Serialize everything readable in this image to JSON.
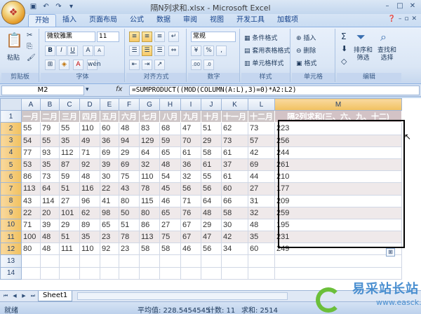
{
  "window": {
    "title": "隔N列求和.xlsx - Microsoft Excel"
  },
  "tabs": [
    "开始",
    "插入",
    "页面布局",
    "公式",
    "数据",
    "审阅",
    "视图",
    "开发工具",
    "加载项"
  ],
  "ribbon": {
    "clipboard": {
      "paste": "粘贴",
      "label": "剪贴板"
    },
    "font": {
      "name": "微软雅黑",
      "size": "11",
      "label": "字体"
    },
    "align": {
      "label": "对齐方式"
    },
    "number": {
      "format": "常规",
      "label": "数字"
    },
    "styles": {
      "cond": "条件格式",
      "table": "套用表格格式",
      "cell": "单元格样式",
      "label": "样式"
    },
    "cells": {
      "insert": "插入",
      "delete": "删除",
      "format": "格式",
      "label": "单元格"
    },
    "edit": {
      "sort": "排序和\n筛选",
      "find": "查找和\n选择",
      "label": "编辑"
    }
  },
  "formula_bar": {
    "name_box": "M2",
    "fx": "fx",
    "formula": "=SUMPRODUCT((MOD(COLUMN(A:L),3)=0)*A2:L2)"
  },
  "sheet": {
    "columns": [
      "A",
      "B",
      "C",
      "D",
      "E",
      "F",
      "G",
      "H",
      "I",
      "J",
      "K",
      "L",
      "M"
    ],
    "header": [
      "一月",
      "二月",
      "三月",
      "四月",
      "五月",
      "六月",
      "七月",
      "八月",
      "九月",
      "十月",
      "十一月",
      "十二月",
      "隔2列求和(三、六、九、十二)"
    ],
    "rows": [
      [
        55,
        79,
        55,
        110,
        60,
        48,
        83,
        68,
        47,
        51,
        62,
        73,
        223
      ],
      [
        54,
        55,
        35,
        49,
        36,
        94,
        129,
        59,
        70,
        29,
        73,
        57,
        256
      ],
      [
        77,
        93,
        112,
        71,
        69,
        29,
        64,
        65,
        61,
        58,
        61,
        42,
        244
      ],
      [
        53,
        35,
        87,
        92,
        39,
        69,
        32,
        48,
        36,
        61,
        37,
        69,
        261
      ],
      [
        86,
        73,
        59,
        48,
        30,
        75,
        110,
        54,
        32,
        55,
        61,
        44,
        210
      ],
      [
        113,
        64,
        51,
        116,
        22,
        43,
        78,
        45,
        56,
        56,
        60,
        27,
        177
      ],
      [
        43,
        114,
        27,
        96,
        41,
        80,
        115,
        46,
        71,
        64,
        66,
        31,
        209
      ],
      [
        22,
        20,
        101,
        62,
        98,
        50,
        80,
        65,
        76,
        48,
        58,
        32,
        259
      ],
      [
        71,
        39,
        29,
        89,
        65,
        51,
        86,
        27,
        67,
        29,
        30,
        48,
        195
      ],
      [
        100,
        48,
        51,
        35,
        23,
        78,
        113,
        75,
        67,
        47,
        42,
        35,
        231
      ],
      [
        80,
        48,
        111,
        110,
        92,
        23,
        58,
        58,
        46,
        56,
        34,
        60,
        249
      ]
    ],
    "row_numbers": [
      "1",
      "2",
      "3",
      "4",
      "5",
      "6",
      "7",
      "8",
      "9",
      "10",
      "11",
      "12",
      "13",
      "14"
    ]
  },
  "sheet_tab": "Sheet1",
  "status": {
    "ready": "就绪",
    "average": "平均值: 228.5454545",
    "count": "计数: 11",
    "sum": "求和: 2514"
  },
  "watermark": {
    "text": "易采站长站",
    "url": "www.easck.com"
  }
}
